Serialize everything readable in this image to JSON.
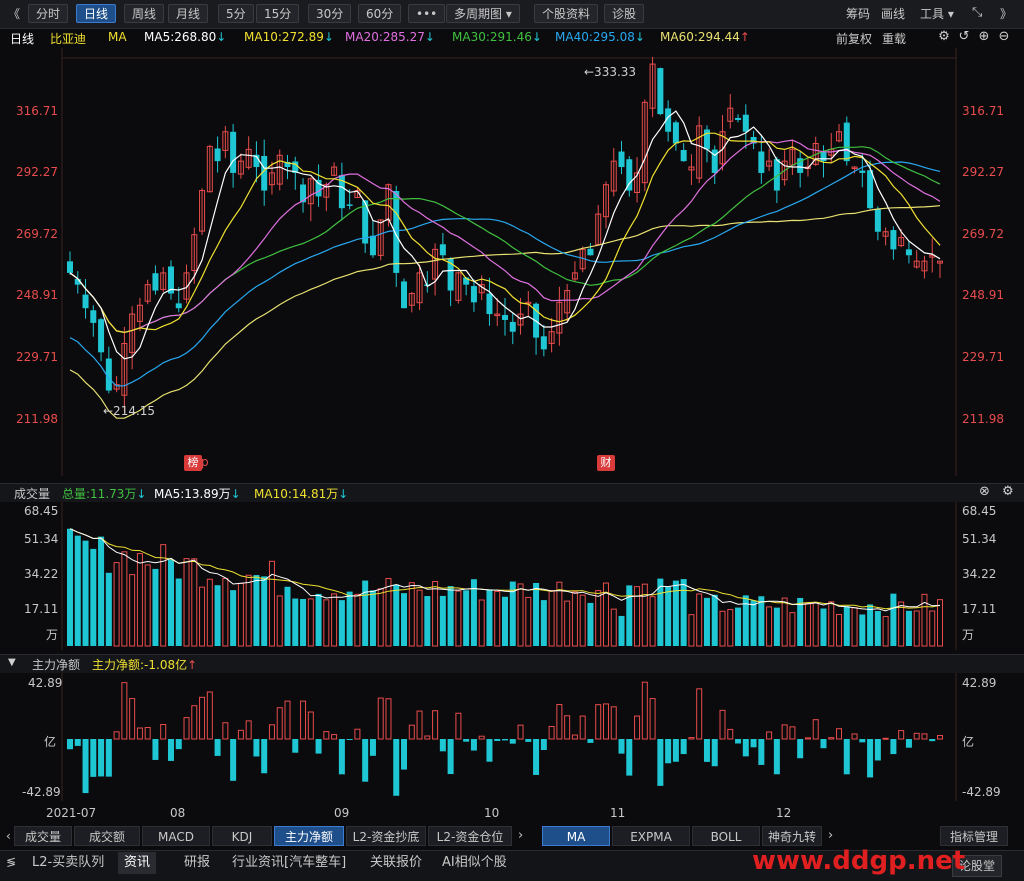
{
  "toolbar": {
    "back": "《",
    "periods": [
      "分时",
      "日线",
      "周线",
      "月线",
      "5分",
      "15分",
      "30分",
      "60分",
      "•••"
    ],
    "active_period": "日线",
    "multi_period": "多周期图",
    "stock_info": "个股资料",
    "diagnose": "诊股",
    "chips": "筹码",
    "draw": "画线",
    "tools": "工具",
    "forward": "》"
  },
  "ma_legend": {
    "period": "日线",
    "stock_name": "比亚迪",
    "ma_label": "MA",
    "ma5": "MA5:268.80",
    "ma10": "MA10:272.89",
    "ma20": "MA20:285.27",
    "ma30": "MA30:291.46",
    "ma40": "MA40:295.08",
    "ma60": "MA60:294.44",
    "fq": "前复权",
    "download": "重载"
  },
  "price_axis": [
    "316.71",
    "292.27",
    "269.72",
    "248.91",
    "229.71",
    "211.98"
  ],
  "annotations": {
    "high": "←333.33",
    "low": "←214.15",
    "badge1": "榜",
    "badge1_tail": "p",
    "badge2": "财"
  },
  "volume": {
    "title": "成交量",
    "total": "总量:11.73万",
    "ma5": "MA5:13.89万",
    "ma10": "MA10:14.81万",
    "axis": [
      "68.45",
      "51.34",
      "34.22",
      "17.11",
      "万"
    ]
  },
  "netflow": {
    "title": "主力净额",
    "value": "主力净额:-1.08亿",
    "axis_top": "42.89",
    "axis_mid": "亿",
    "axis_bot": "-42.89"
  },
  "months": [
    "2021-07",
    "08",
    "09",
    "10",
    "11",
    "12"
  ],
  "indicator_tabs": [
    "成交量",
    "成交额",
    "MACD",
    "KDJ",
    "主力净额",
    "L2-资金抄底",
    "L2-资金仓位"
  ],
  "active_indicator": "主力净额",
  "overlay_tabs": [
    "MA",
    "EXPMA",
    "BOLL",
    "神奇九转"
  ],
  "indicator_manage": "指标管理",
  "info_tabs": [
    "L2-买卖队列",
    "资讯",
    "研报",
    "行业资讯[汽车整车]",
    "关联报价",
    "AI相似个股"
  ],
  "active_info": "资讯",
  "diag_btn": "论股堂",
  "watermark": "www.ddgp.net",
  "colors": {
    "up": "#e84c4c",
    "down": "#1fc7d4",
    "ma5": "#ffffff",
    "ma10": "#f0e030",
    "ma20": "#e070e0",
    "ma30": "#40c040",
    "ma40": "#28a8f0",
    "ma60": "#e8e070"
  },
  "chart_data": {
    "type": "candlestick",
    "title": "比亚迪 日线",
    "ohlc_note": "approximate daily closes (2021-07 to 2021-12)",
    "closes": [
      262,
      258,
      250,
      245,
      235,
      222,
      224,
      238,
      248,
      251,
      258,
      256,
      262,
      255,
      250,
      262,
      275,
      290,
      305,
      300,
      310,
      296,
      300,
      304,
      298,
      290,
      296,
      302,
      298,
      296,
      286,
      294,
      288,
      292,
      298,
      284,
      285,
      290,
      272,
      268,
      280,
      292,
      262,
      250,
      255,
      262,
      258,
      270,
      268,
      256,
      262,
      258,
      252,
      258,
      248,
      248,
      246,
      242,
      248,
      252,
      240,
      236,
      242,
      252,
      256,
      262,
      270,
      268,
      282,
      292,
      300,
      298,
      290,
      296,
      320,
      333,
      316,
      310,
      306,
      300,
      298,
      312,
      304,
      296,
      310,
      318,
      314,
      310,
      306,
      296,
      300,
      290,
      300,
      304,
      296,
      298,
      306,
      300,
      304,
      310,
      300,
      298,
      296,
      284,
      276,
      276,
      270,
      274,
      268,
      266,
      266,
      268,
      266
    ]
  }
}
